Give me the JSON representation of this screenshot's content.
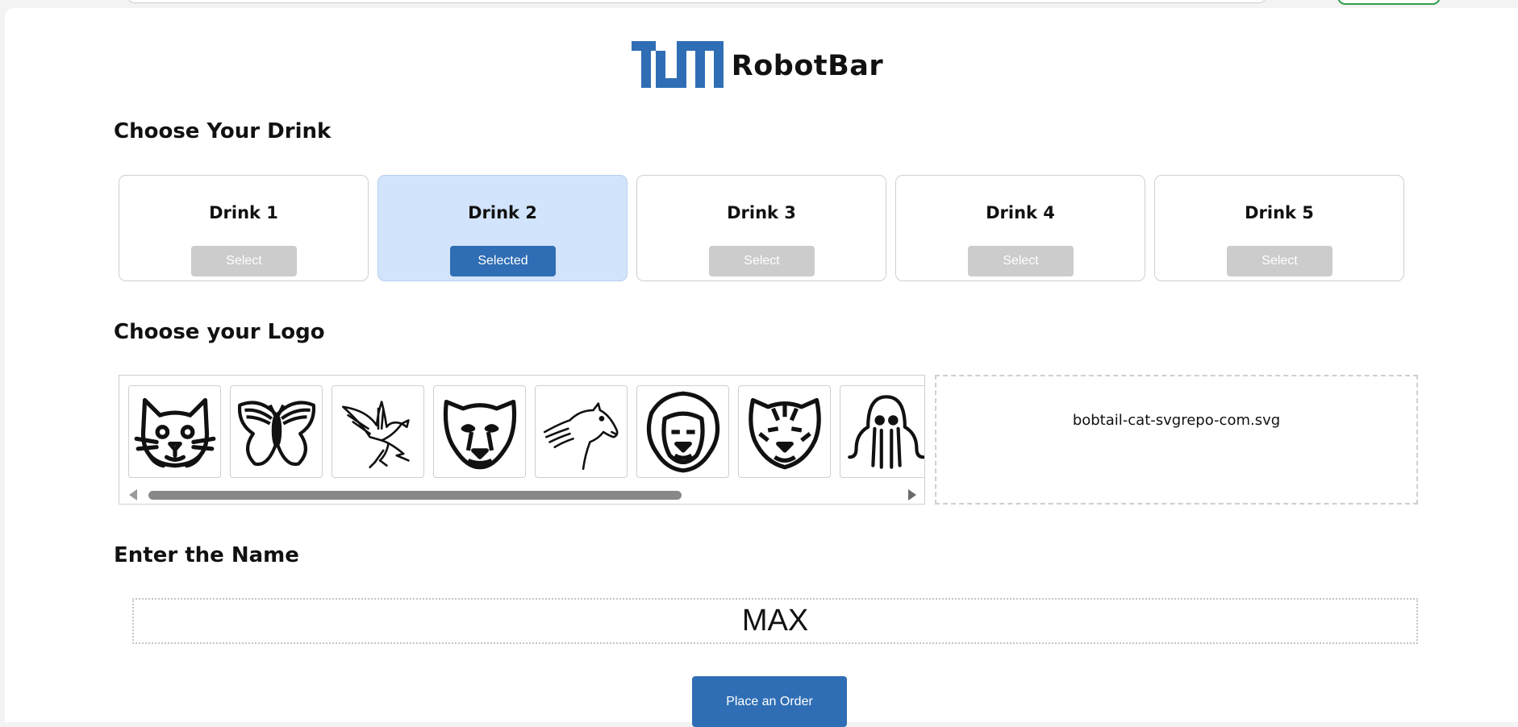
{
  "app": {
    "title": "RobotBar",
    "logo_icon": "tum-logo-icon",
    "brand_color": "#2f6eb5"
  },
  "drinks": {
    "heading": "Choose Your Drink",
    "items": [
      {
        "name": "Drink 1",
        "button_label": "Select",
        "selected": false
      },
      {
        "name": "Drink 2",
        "button_label": "Selected",
        "selected": true
      },
      {
        "name": "Drink 3",
        "button_label": "Select",
        "selected": false
      },
      {
        "name": "Drink 4",
        "button_label": "Select",
        "selected": false
      },
      {
        "name": "Drink 5",
        "button_label": "Select",
        "selected": false
      }
    ]
  },
  "logos": {
    "heading": "Choose your Logo",
    "items": [
      {
        "icon": "cat-icon"
      },
      {
        "icon": "butterfly-icon"
      },
      {
        "icon": "eagle-icon"
      },
      {
        "icon": "cheetah-icon"
      },
      {
        "icon": "horse-icon"
      },
      {
        "icon": "lion-icon"
      },
      {
        "icon": "tiger-icon"
      },
      {
        "icon": "octopus-icon"
      }
    ],
    "selected_file": "bobtail-cat-svgrepo-com.svg"
  },
  "name_entry": {
    "heading": "Enter the Name",
    "value": "MAX"
  },
  "order": {
    "button_label": "Place an Order"
  }
}
